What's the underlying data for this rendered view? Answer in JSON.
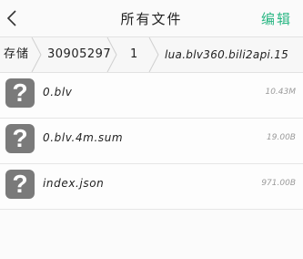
{
  "header": {
    "title": "所有文件",
    "edit_label": "编辑",
    "back_icon": "chevron-left-icon"
  },
  "breadcrumb": {
    "items": [
      "存储",
      "30905297",
      "1",
      "lua.blv360.bili2api.15"
    ],
    "separator_icon": "chevron-right-icon"
  },
  "files": [
    {
      "name": "0.blv",
      "size": "10.43M",
      "icon": "unknown-file-icon"
    },
    {
      "name": "0.blv.4m.sum",
      "size": "19.00B",
      "icon": "unknown-file-icon"
    },
    {
      "name": "index.json",
      "size": "971.00B",
      "icon": "unknown-file-icon"
    }
  ],
  "colors": {
    "accent": "#2bb784",
    "file_icon_bg": "#7a7a7a"
  }
}
